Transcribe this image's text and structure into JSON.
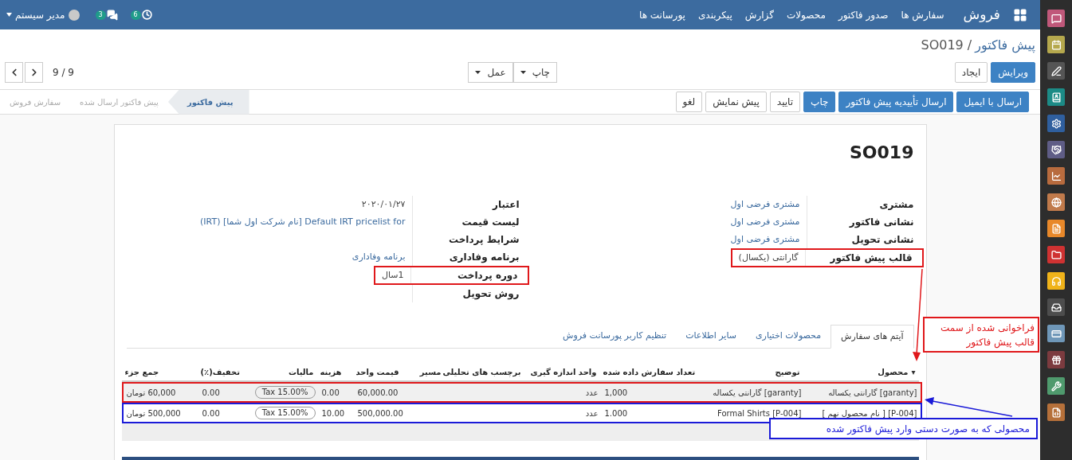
{
  "navbar": {
    "app_title": "فروش",
    "menu": [
      "سفارش ها",
      "صدور فاکتور",
      "محصولات",
      "گزارش",
      "پیکربندی",
      "پورسانت ها"
    ],
    "user": "مدیر سیستم",
    "messages_count": "3",
    "activities_count": "6"
  },
  "control_panel": {
    "breadcrumb": {
      "parent": "پیش فاکتور",
      "current": "/ SO019"
    },
    "buttons": [
      {
        "label": "ویرایش",
        "primary": true
      },
      {
        "label": "ایجاد",
        "primary": false
      }
    ],
    "dropdowns": [
      "چاپ",
      "عمل"
    ],
    "pager": "9 / 9"
  },
  "statusbar": {
    "buttons": [
      {
        "label": "ارسال با ایمیل",
        "primary": true
      },
      {
        "label": "ارسال تأییدیه پیش فاکتور",
        "primary": true
      },
      {
        "label": "چاپ",
        "primary": true
      },
      {
        "label": "تایید",
        "primary": false
      },
      {
        "label": "پیش نمایش",
        "primary": false
      },
      {
        "label": "لغو",
        "primary": false
      }
    ],
    "stages": [
      {
        "label": "پیش فاکتور",
        "selected": true
      },
      {
        "label": "پیش فاکتور ارسال شده",
        "selected": false
      },
      {
        "label": "سفارش فروش",
        "selected": false
      }
    ]
  },
  "sheet": {
    "title": "SO019",
    "groups": [
      [
        {
          "label": "مشتری",
          "value": "مشتری فرضی اول",
          "link": true
        },
        {
          "label": "نشانی فاکتور",
          "value": "مشتری فرضی اول",
          "link": true
        },
        {
          "label": "نشانی تحویل",
          "value": "مشتری فرضی اول",
          "link": true
        },
        {
          "label": "قالب پیش فاکتور",
          "value": "گارانتی (یکسال)",
          "link": false,
          "color": "#e0181b"
        }
      ],
      [
        {
          "label": "اعتبار",
          "value": "۲۰۲۰/۰۱/۲۷",
          "link": false
        },
        {
          "label": "لیست قیمت",
          "value": "Default IRT pricelist for [نام شرکت اول شما] (IRT)",
          "link": true
        },
        {
          "label": "شرایط پرداخت"
        },
        {
          "label": "برنامه وفاداری",
          "value": "برنامه وفاداری",
          "link": true
        },
        {
          "label": "دوره پرداخت",
          "value": "1سال",
          "link": false,
          "color": "#e0181b"
        },
        {
          "label": "روش تحویل"
        }
      ]
    ],
    "tabs": [
      {
        "label": "آیتم های سفارش",
        "selected": true
      },
      {
        "label": "محصولات اختیاری",
        "selected": false
      },
      {
        "label": "سایر اطلاعات",
        "selected": false
      },
      {
        "label": "تنظیم کاربر پورسانت فروش",
        "selected": false
      }
    ],
    "table": {
      "columns": [
        "محصول",
        "توضیح",
        "تعداد سفارش داده شده",
        "واحد اندازه گیری",
        "برچسب های تحلیلی",
        "مسیر",
        "قیمت واحد",
        "هزینه",
        "مالیات",
        "تخفیف(٪)",
        "جمع جزء"
      ],
      "sort_marker": "▾",
      "rows": [
        {
          "product": "[garanty] گارانتی یکساله",
          "description": "[garanty] گارانتی یکساله",
          "quantity": "1,000",
          "uom": "عدد",
          "unit_price": "60,000.00",
          "cost": "0.00",
          "tax": "Tax 15.00%",
          "discount": "0.00",
          "subtotal": "60,000 تومان",
          "selected": true,
          "color": "#e0181b"
        },
        {
          "product": "[P-004] [ نام محصول نهم ]",
          "description": "[P-004] Formal Shirts",
          "quantity": "1.000",
          "uom": "عدد",
          "unit_price": "500,000.00",
          "cost": "10.00",
          "tax": "Tax 15.00%",
          "discount": "0.00",
          "subtotal": "500,000 تومان",
          "selected": false,
          "color": "#1a1ad8"
        }
      ]
    }
  },
  "annotations": [
    {
      "lines": [
        "فراخوانی شده از سمت",
        "قالب پیش فاکتور"
      ],
      "color": "#e0181b"
    },
    {
      "lines": [
        "محصولی که به صورت دستی وارد پیش فاکتور شده"
      ],
      "color": "#1a1ad8"
    }
  ]
}
